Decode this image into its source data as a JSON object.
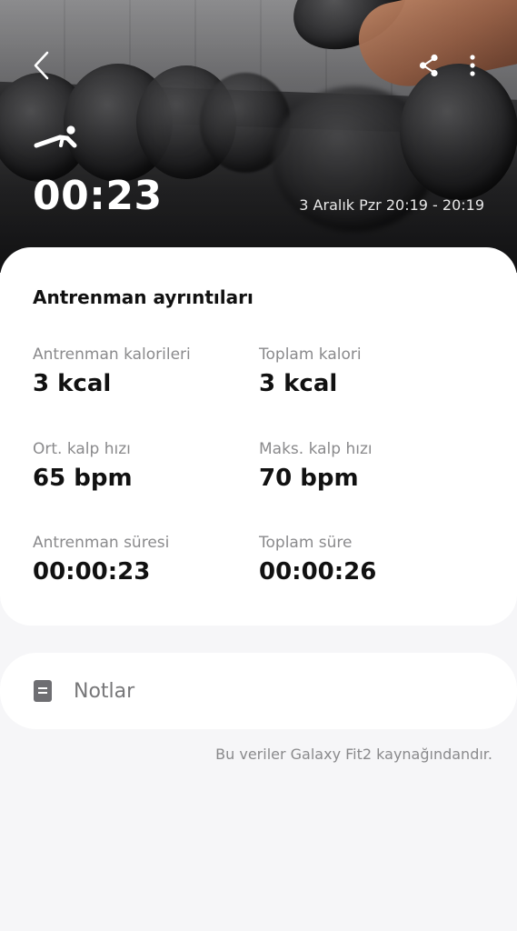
{
  "header": {
    "back_icon": "chevron-left-icon",
    "share_icon": "share-icon",
    "more_icon": "more-vertical-icon",
    "workout_type_icon": "plank-exercise-icon",
    "duration": "00:23",
    "date_range": "3 Aralık Pzr 20:19 - 20:19"
  },
  "details": {
    "title": "Antrenman ayrıntıları",
    "stats": [
      {
        "label": "Antrenman kalorileri",
        "value": "3 kcal"
      },
      {
        "label": "Toplam kalori",
        "value": "3 kcal"
      },
      {
        "label": "Ort. kalp hızı",
        "value": "65 bpm"
      },
      {
        "label": "Maks. kalp hızı",
        "value": "70 bpm"
      },
      {
        "label": "Antrenman süresi",
        "value": "00:00:23"
      },
      {
        "label": "Toplam süre",
        "value": "00:00:26"
      }
    ]
  },
  "notes": {
    "icon": "note-icon",
    "label": "Notlar"
  },
  "footer": {
    "source": "Bu veriler Galaxy Fit2 kaynağındandır."
  }
}
